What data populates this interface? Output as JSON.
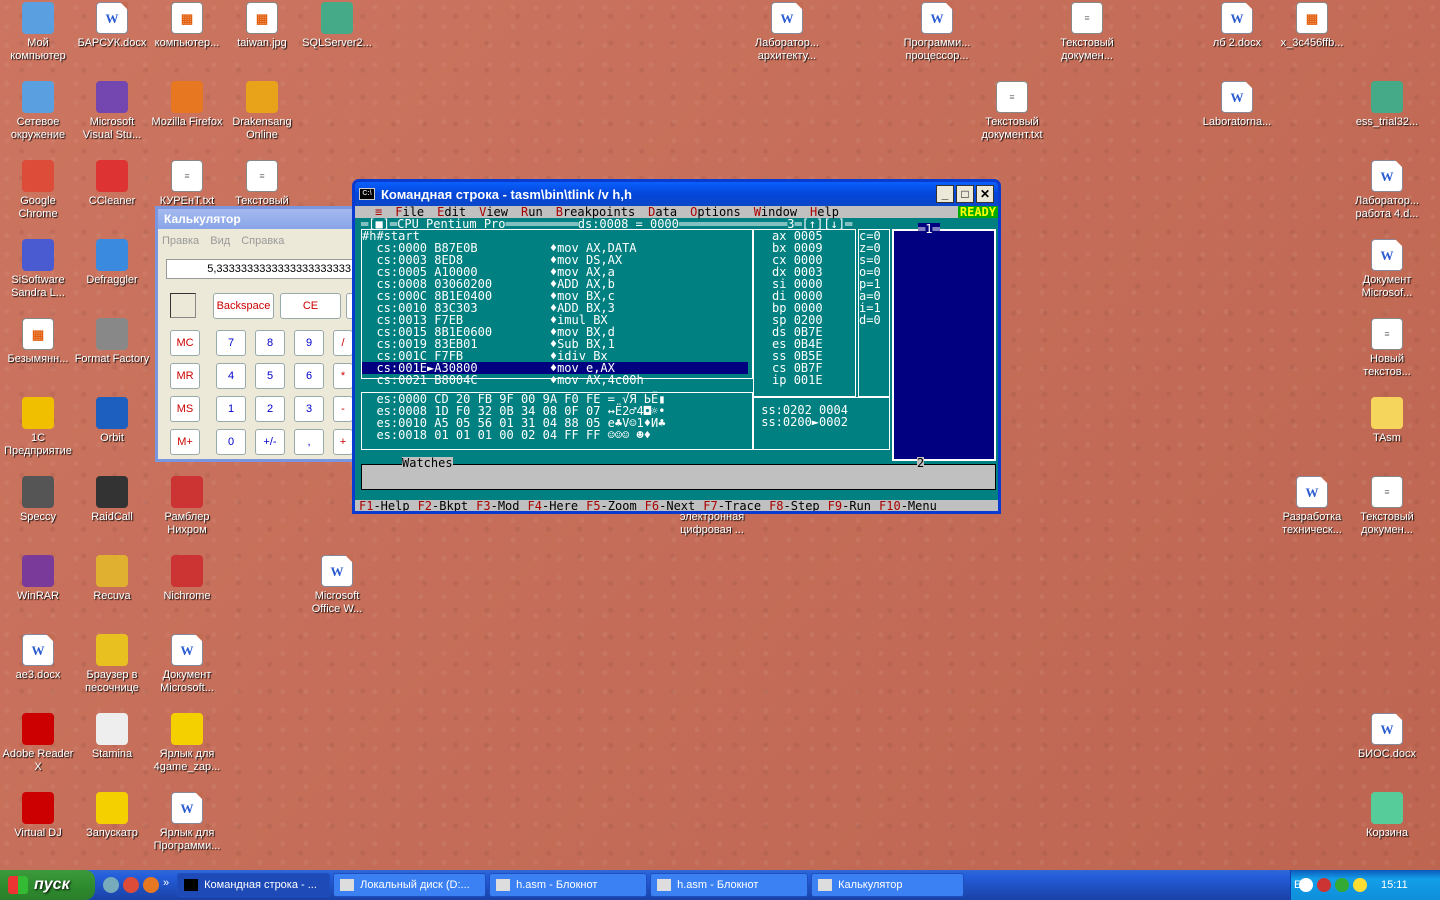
{
  "desktop_icons": [
    {
      "label": "Мой компьютер",
      "icon": "my-computer-icon",
      "color": "#5aa0e0",
      "kind": "app"
    },
    {
      "label": "БАРСУК.docx",
      "icon": "word-doc-icon",
      "kind": "doc"
    },
    {
      "label": "компьютер...",
      "icon": "image-file-icon",
      "kind": "img"
    },
    {
      "label": "taiwan.jpg",
      "icon": "image-file-icon",
      "kind": "img"
    },
    {
      "label": "SQLServer2...",
      "icon": "installer-icon",
      "color": "#4a8",
      "kind": "app"
    },
    {
      "label": "Сетевое окружение",
      "icon": "network-icon",
      "color": "#5aa0e0",
      "kind": "app"
    },
    {
      "label": "Microsoft Visual Stu...",
      "icon": "visual-studio-icon",
      "color": "#7446b0",
      "kind": "app"
    },
    {
      "label": "Mozilla Firefox",
      "icon": "firefox-icon",
      "color": "#e87722",
      "kind": "app"
    },
    {
      "label": "Drakensang Online",
      "icon": "drakensang-icon",
      "color": "#e9a31a",
      "kind": "app"
    },
    {
      "label": "Google Chrome",
      "icon": "chrome-icon",
      "color": "#dd4b39",
      "kind": "app"
    },
    {
      "label": "CCleaner",
      "icon": "ccleaner-icon",
      "color": "#d33",
      "kind": "app"
    },
    {
      "label": "КУРЕнТ.txt",
      "icon": "text-file-icon",
      "kind": "txt"
    },
    {
      "label": "Текстовый",
      "icon": "text-file-icon",
      "kind": "txt"
    },
    {
      "label": "SiSoftware Sandra L...",
      "icon": "sandra-icon",
      "color": "#4a5ad0",
      "kind": "app"
    },
    {
      "label": "Defraggler",
      "icon": "defraggler-icon",
      "color": "#3a8ae0",
      "kind": "app"
    },
    {
      "label": "Безымянн...",
      "icon": "image-file-icon",
      "kind": "img"
    },
    {
      "label": "Format Factory",
      "icon": "format-factory-icon",
      "color": "#888",
      "kind": "app"
    },
    {
      "label": "1С Предприятие",
      "icon": "1c-icon",
      "color": "#f0c000",
      "kind": "app"
    },
    {
      "label": "Orbit",
      "icon": "orbit-icon",
      "color": "#1d5fbf",
      "kind": "app"
    },
    {
      "label": "Speccy",
      "icon": "speccy-icon",
      "color": "#555",
      "kind": "app"
    },
    {
      "label": "RaidCall",
      "icon": "raidcall-icon",
      "color": "#333",
      "kind": "app"
    },
    {
      "label": "Рамблер Нихром",
      "icon": "nichrome-icon",
      "color": "#c33",
      "kind": "app"
    },
    {
      "label": "WinRAR",
      "icon": "winrar-icon",
      "color": "#7a3a9a",
      "kind": "app"
    },
    {
      "label": "Recuva",
      "icon": "recuva-icon",
      "color": "#e0b030",
      "kind": "app"
    },
    {
      "label": "Nichrome",
      "icon": "nichrome-icon",
      "color": "#c33",
      "kind": "app"
    },
    {
      "label": "Microsoft Office W...",
      "icon": "word-icon",
      "kind": "doc"
    },
    {
      "label": "ae3.docx",
      "icon": "word-doc-icon",
      "kind": "doc"
    },
    {
      "label": "Браузер в песочнице",
      "icon": "sandbox-browser-icon",
      "color": "#e8c020",
      "kind": "app"
    },
    {
      "label": "Документ Microsoft...",
      "icon": "word-doc-icon",
      "kind": "doc"
    },
    {
      "label": "Adobe Reader X",
      "icon": "adobe-reader-icon",
      "color": "#c00",
      "kind": "app"
    },
    {
      "label": "Stamina",
      "icon": "stamina-icon",
      "color": "#eee",
      "kind": "app"
    },
    {
      "label": "Ярлык для 4game_zap...",
      "icon": "4game-icon",
      "color": "#f5d000",
      "kind": "app"
    },
    {
      "label": "Virtual DJ",
      "icon": "virtual-dj-icon",
      "color": "#c00",
      "kind": "app"
    },
    {
      "label": "Запускатр",
      "icon": "4game-icon",
      "color": "#f5d000",
      "kind": "app"
    },
    {
      "label": "Ярлык для Программи...",
      "icon": "word-doc-icon",
      "kind": "doc"
    },
    {
      "label": "Лаборатор... архитекту...",
      "icon": "word-doc-icon",
      "kind": "doc"
    },
    {
      "label": "Программи... процессор...",
      "icon": "word-doc-icon",
      "kind": "doc"
    },
    {
      "label": "Текстовый докумен...",
      "icon": "text-file-icon",
      "kind": "txt"
    },
    {
      "label": "лб 2.docx",
      "icon": "word-doc-icon",
      "kind": "doc"
    },
    {
      "label": "x_3c456ffb...",
      "icon": "image-file-icon",
      "kind": "img"
    },
    {
      "label": "Текстовый документ.txt",
      "icon": "text-file-icon",
      "kind": "txt"
    },
    {
      "label": "Laboratorna...",
      "icon": "word-doc-icon",
      "kind": "doc"
    },
    {
      "label": "ess_trial32...",
      "icon": "installer-icon",
      "color": "#4a8",
      "kind": "app"
    },
    {
      "label": "Лаборатор... работа 4.d...",
      "icon": "word-doc-icon",
      "kind": "doc"
    },
    {
      "label": "Документ Microsof...",
      "icon": "word-doc-icon",
      "kind": "doc"
    },
    {
      "label": "Новый текстов...",
      "icon": "text-file-icon",
      "kind": "txt"
    },
    {
      "label": "TAsm",
      "icon": "folder-icon",
      "color": "#f6d55c",
      "kind": "app"
    },
    {
      "label": "Разработка техническ...",
      "icon": "word-doc-icon",
      "kind": "doc"
    },
    {
      "label": "Текстовый докумен...",
      "icon": "text-file-icon",
      "kind": "txt"
    },
    {
      "label": "электронная цифровая ...",
      "icon": "word-doc-icon",
      "kind": "doc"
    },
    {
      "label": "БИОС.docx",
      "icon": "word-doc-icon",
      "kind": "doc"
    },
    {
      "label": "Корзина",
      "icon": "recycle-bin-icon",
      "color": "#5c9",
      "kind": "app"
    }
  ],
  "cmd_window": {
    "title": "Командная строка - tasm\\bin\\tlink /v h,h",
    "menu": [
      {
        "hk": "≡",
        "rest": ""
      },
      {
        "hk": "F",
        "rest": "ile"
      },
      {
        "hk": "E",
        "rest": "dit"
      },
      {
        "hk": "V",
        "rest": "iew"
      },
      {
        "hk": "R",
        "rest": "un"
      },
      {
        "hk": "B",
        "rest": "reakpoints"
      },
      {
        "hk": "D",
        "rest": "ata"
      },
      {
        "hk": "O",
        "rest": "ptions"
      },
      {
        "hk": "W",
        "rest": "indow"
      },
      {
        "hk": "H",
        "rest": "elp"
      }
    ],
    "ready": "READY",
    "cpu_header": "═[■]═CPU Pentium Pro══════════ds:0008 = 0000═══════════════3═[↑][↓]═",
    "code_lines": [
      "#h#start",
      "  cs:0000 B87E0B          ♦mov AX,DATA",
      "  cs:0003 8ED8            ♦mov DS,AX",
      "  cs:0005 A10000          ♦mov AX,a",
      "  cs:0008 03060200        ♦ADD AX,b",
      "  cs:000C 8B1E0400        ♦mov BX,c",
      "  cs:0010 83C303          ♦ADD BX,3",
      "  cs:0013 F7EB            ♦imul BX",
      "  cs:0015 8B1E0600        ♦mov BX,d",
      "  cs:0019 83EB01          ♦Sub BX,1",
      "  cs:001C F7FB            ♦idiv Bx",
      "  cs:001E►A30800          ♦mov e,AX",
      "  cs:0021 B8004C          ♦mov AX,4c00h"
    ],
    "dump_lines": [
      "  es:0000 CD 20 FB 9F 00 9A F0 FE = √Я ЬЁ▮",
      "  es:0008 1D F0 32 0B 34 08 0F 07 ↔Ё2♂4◘☼•",
      "  es:0010 A5 05 56 01 31 04 88 05 е♣V☺1♦И♣",
      "  es:0018 01 01 01 00 02 04 FF FF ☺☺☺ ☻♦"
    ],
    "registers": [
      {
        "name": "ax",
        "value": "0005",
        "changed": true
      },
      {
        "name": "bx",
        "value": "0009",
        "changed": false
      },
      {
        "name": "cx",
        "value": "0000",
        "changed": false
      },
      {
        "name": "dx",
        "value": "0003",
        "changed": true
      },
      {
        "name": "si",
        "value": "0000",
        "changed": false
      },
      {
        "name": "di",
        "value": "0000",
        "changed": false
      },
      {
        "name": "bp",
        "value": "0000",
        "changed": false
      },
      {
        "name": "sp",
        "value": "0200",
        "changed": false
      },
      {
        "name": "ds",
        "value": "0B7E",
        "changed": false
      },
      {
        "name": "es",
        "value": "0B4E",
        "changed": false
      },
      {
        "name": "ss",
        "value": "0B5E",
        "changed": false
      },
      {
        "name": "cs",
        "value": "0B7F",
        "changed": false
      },
      {
        "name": "ip",
        "value": "001E",
        "changed": true
      }
    ],
    "flags": [
      "c=0",
      "z=0",
      "s=0",
      "o=0",
      "p=1",
      "a=0",
      "i=1",
      "d=0"
    ],
    "stack_lines": [
      " ss:0202 0004",
      " ss:0200►0002"
    ],
    "window1_label": "═1═",
    "watches_label": "Watches",
    "watches_num": "2",
    "fkeys": [
      {
        "k": "F1",
        "t": "-Help"
      },
      {
        "k": "F2",
        "t": "-Bkpt"
      },
      {
        "k": "F3",
        "t": "-Mod"
      },
      {
        "k": "F4",
        "t": "-Here"
      },
      {
        "k": "F5",
        "t": "-Zoom"
      },
      {
        "k": "F6",
        "t": "-Next"
      },
      {
        "k": "F7",
        "t": "-Trace"
      },
      {
        "k": "F8",
        "t": "-Step"
      },
      {
        "k": "F9",
        "t": "-Run"
      },
      {
        "k": "F10",
        "t": "-Menu"
      }
    ]
  },
  "calculator": {
    "title": "Калькулятор",
    "menu": [
      "Правка",
      "Вид",
      "Справка"
    ],
    "display": "5,3333333333333333333333",
    "row1": [
      "Backspace",
      "CE"
    ],
    "mem": [
      "MC",
      "MR",
      "MS",
      "M+"
    ],
    "digits": [
      [
        "7",
        "8",
        "9",
        "/"
      ],
      [
        "4",
        "5",
        "6",
        "*"
      ],
      [
        "1",
        "2",
        "3",
        "-"
      ],
      [
        "0",
        "+/-",
        ",",
        "+"
      ]
    ]
  },
  "taskbar": {
    "start": "пуск",
    "tasks": [
      "Командная строка - ...",
      "Локальный диск (D:...",
      "h.asm - Блокнот",
      "h.asm - Блокнот",
      "Калькулятор"
    ],
    "lang": "EN",
    "clock": "15:11"
  }
}
